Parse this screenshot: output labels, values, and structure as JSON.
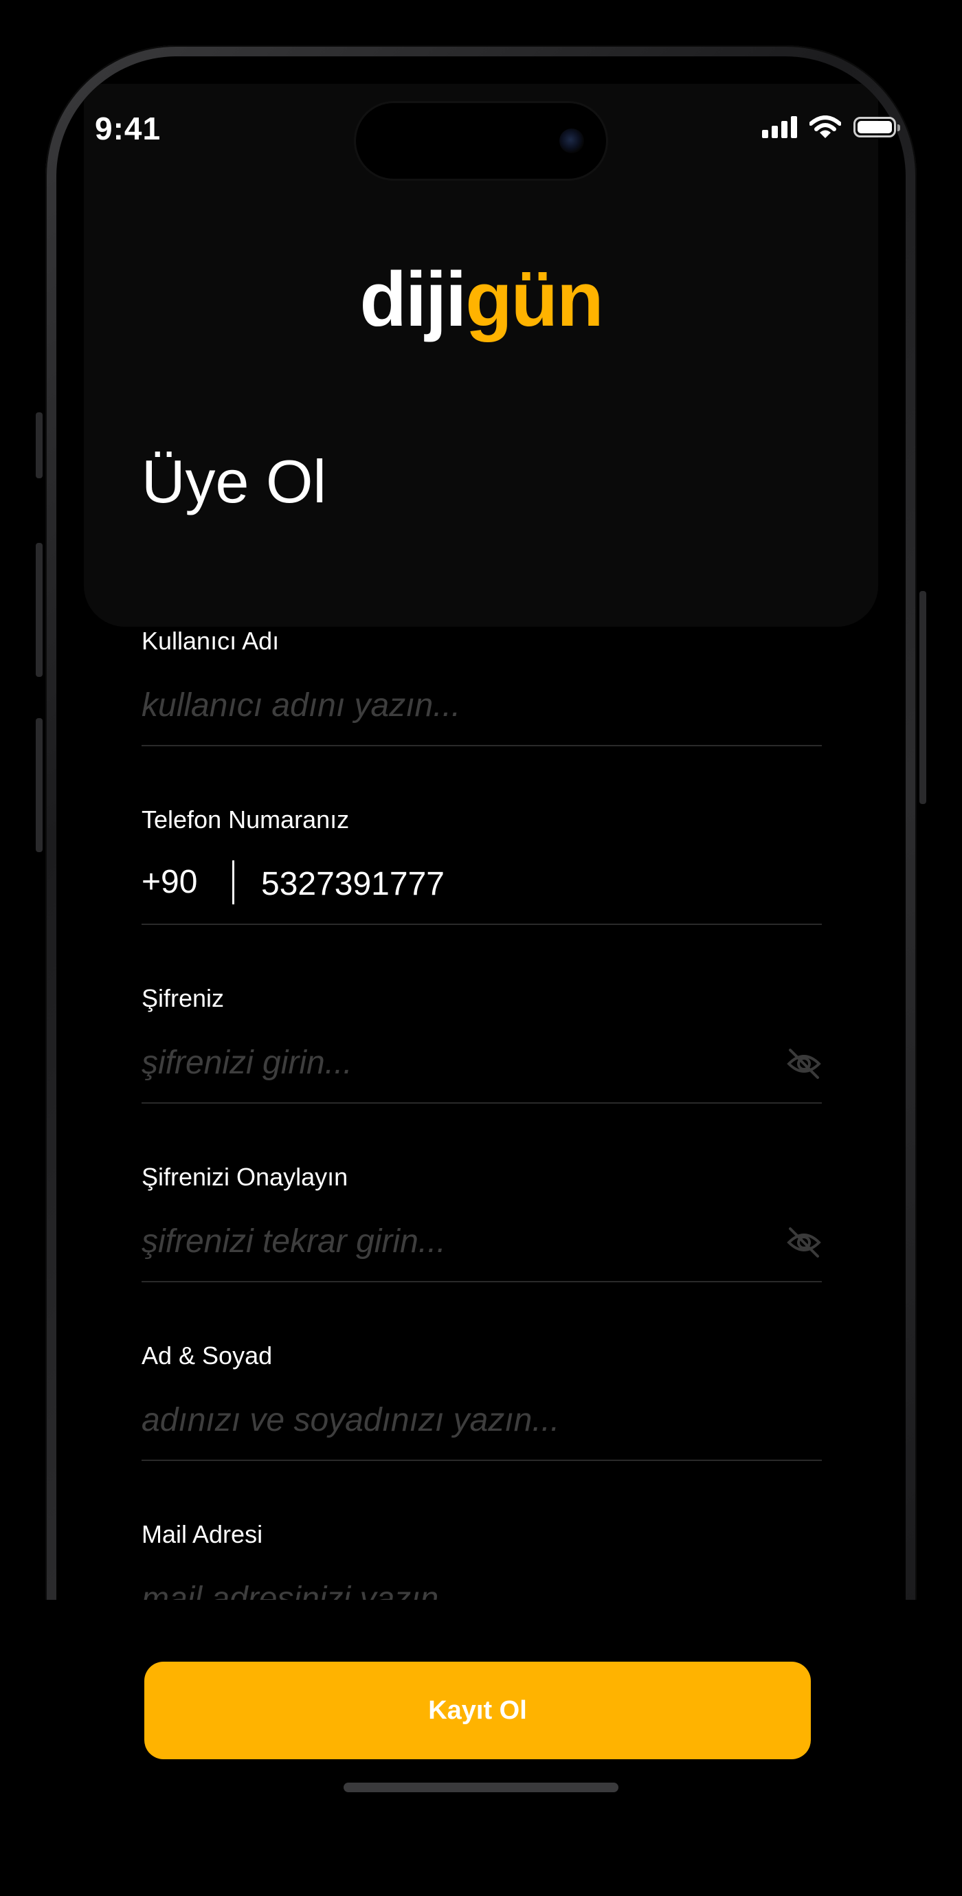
{
  "status_bar": {
    "time": "9:41",
    "icons": [
      "signal-icon",
      "wifi-icon",
      "battery-icon"
    ]
  },
  "brand": {
    "logo_white": "diji",
    "logo_yellow": "gün",
    "accent_color": "#FFB300"
  },
  "page": {
    "title": "Üye Ol"
  },
  "form": {
    "username": {
      "label": "Kullanıcı Adı",
      "placeholder": "kullanıcı adını yazın...",
      "value": ""
    },
    "phone": {
      "label": "Telefon Numaranız",
      "prefix": "+90",
      "value": "5327391777"
    },
    "password": {
      "label": "Şifreniz",
      "placeholder": "şifrenizi girin...",
      "value": "",
      "toggle_icon": "eye-off-icon"
    },
    "password_confirm": {
      "label": "Şifrenizi Onaylayın",
      "placeholder": "şifrenizi tekrar girin...",
      "value": "",
      "toggle_icon": "eye-off-icon"
    },
    "full_name": {
      "label": "Ad & Soyad",
      "placeholder": "adınızı ve soyadınızı yazın...",
      "value": ""
    },
    "email": {
      "label": "Mail Adresi",
      "placeholder": "mail adresinizi yazın...",
      "value": ""
    }
  },
  "actions": {
    "submit_label": "Kayıt Ol"
  }
}
